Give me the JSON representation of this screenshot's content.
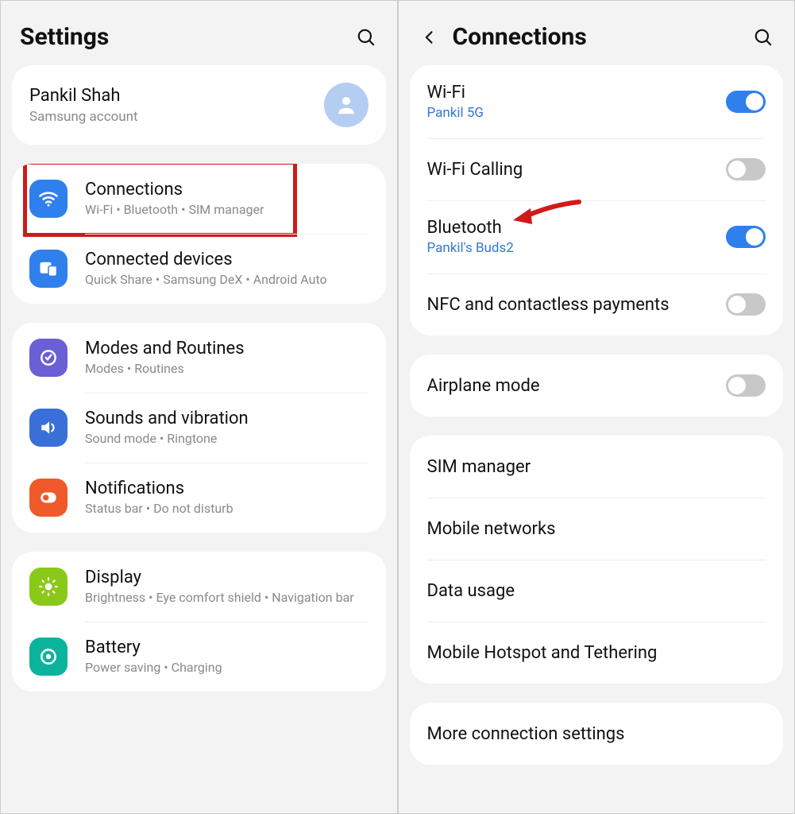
{
  "left": {
    "title": "Settings",
    "account": {
      "name": "Pankil Shah",
      "sub": "Samsung account"
    },
    "group1": [
      {
        "title": "Connections",
        "sub": "Wi-Fi  •  Bluetooth  •  SIM manager",
        "highlighted": true
      },
      {
        "title": "Connected devices",
        "sub": "Quick Share  •  Samsung DeX  •  Android Auto"
      }
    ],
    "group2": [
      {
        "title": "Modes and Routines",
        "sub": "Modes  •  Routines"
      },
      {
        "title": "Sounds and vibration",
        "sub": "Sound mode  •  Ringtone"
      },
      {
        "title": "Notifications",
        "sub": "Status bar  •  Do not disturb"
      }
    ],
    "group3": [
      {
        "title": "Display",
        "sub": "Brightness  •  Eye comfort shield  •  Navigation bar"
      },
      {
        "title": "Battery",
        "sub": "Power saving  •  Charging"
      }
    ]
  },
  "right": {
    "title": "Connections",
    "group1": [
      {
        "title": "Wi-Fi",
        "sub": "Pankil 5G",
        "toggle": "on"
      },
      {
        "title": "Wi-Fi Calling",
        "toggle": "off"
      },
      {
        "title": "Bluetooth",
        "sub": "Pankil's Buds2",
        "toggle": "on",
        "arrow": true
      },
      {
        "title": "NFC and contactless payments",
        "toggle": "off"
      }
    ],
    "group2": [
      {
        "title": "Airplane mode",
        "toggle": "off"
      }
    ],
    "group3": [
      {
        "title": "SIM manager"
      },
      {
        "title": "Mobile networks"
      },
      {
        "title": "Data usage"
      },
      {
        "title": "Mobile Hotspot and Tethering"
      }
    ],
    "group4": [
      {
        "title": "More connection settings"
      }
    ]
  }
}
